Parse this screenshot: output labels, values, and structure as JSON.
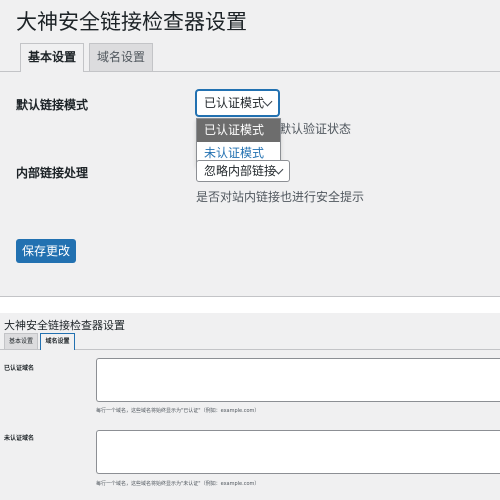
{
  "panel1": {
    "title": "大神安全链接检查器设置",
    "tabs": [
      "基本设置",
      "域名设置"
    ],
    "fields": {
      "default_mode": {
        "label": "默认链接模式",
        "selected": "已认证模式",
        "options": [
          "已认证模式",
          "未认证模式"
        ],
        "help_partial": "默认验证状态"
      },
      "internal_links": {
        "label": "内部链接处理",
        "selected": "忽略内部链接",
        "help": "是否对站内链接也进行安全提示"
      }
    },
    "save_label": "保存更改"
  },
  "panel2": {
    "title": "大神安全链接检查器设置",
    "tabs": [
      "基本设置",
      "域名设置"
    ],
    "verified": {
      "label": "已认证域名",
      "help": "每行一个域名，这些域名将始终显示为\"已认证\"（例如：example.com）"
    },
    "unverified": {
      "label": "未认证域名",
      "help": "每行一个域名，这些域名将始终显示为\"未认证\"（例如：example.com）"
    }
  },
  "colors": {
    "accent": "#2271b1",
    "background": "#f0f0f1",
    "border": "#c3c4c7",
    "highlight": "#6d6d6d"
  }
}
